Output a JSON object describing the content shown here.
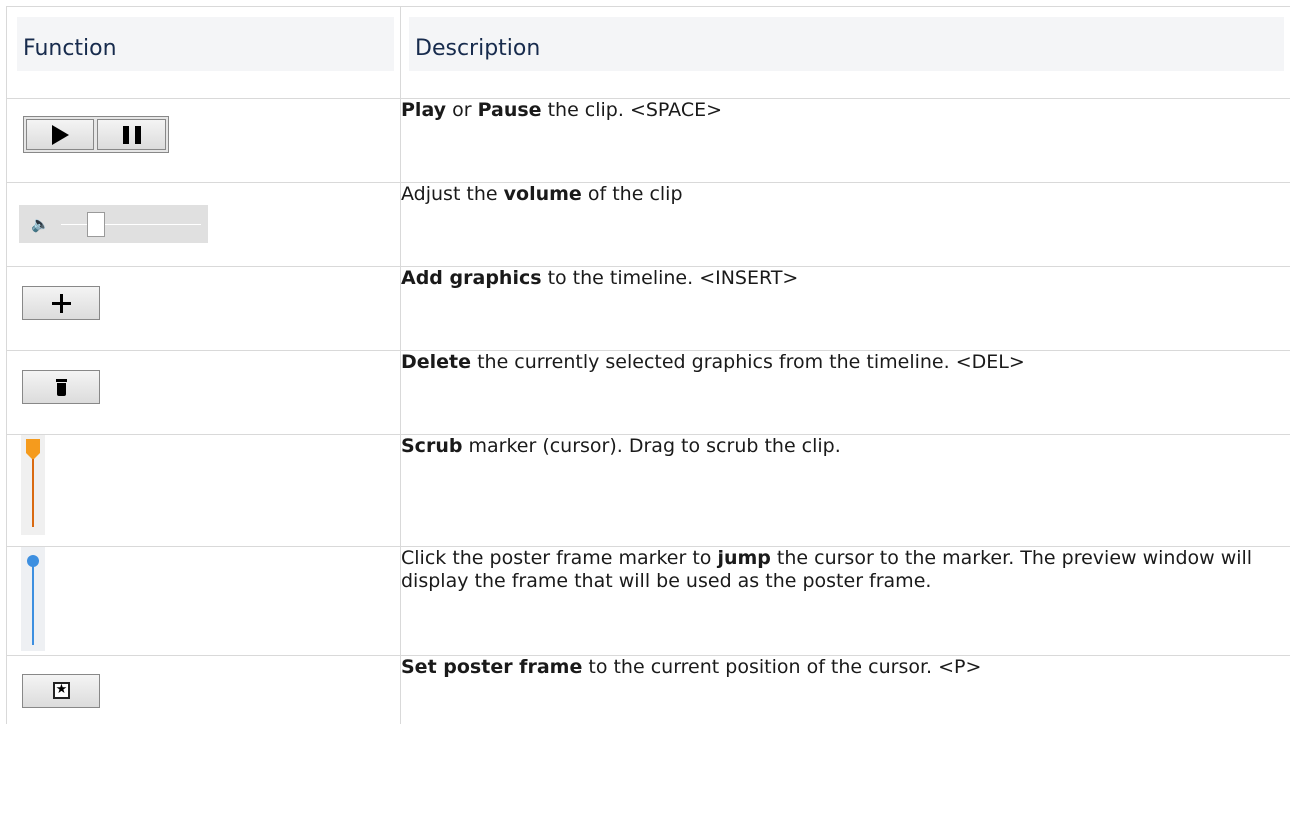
{
  "header": {
    "function": "Function",
    "description": "Description"
  },
  "rows": [
    {
      "icon": "play-pause-buttons",
      "parts": [
        {
          "b": "Play"
        },
        {
          "t": " or "
        },
        {
          "b": "Pause"
        },
        {
          "t": " the clip. <SPACE>"
        }
      ]
    },
    {
      "icon": "volume-slider",
      "parts": [
        {
          "t": "Adjust the "
        },
        {
          "b": "volume"
        },
        {
          "t": " of the clip"
        }
      ]
    },
    {
      "icon": "plus-button",
      "parts": [
        {
          "b": "Add graphics"
        },
        {
          "t": " to the timeline. <INSERT>"
        }
      ]
    },
    {
      "icon": "trash-button",
      "parts": [
        {
          "b": "Delete"
        },
        {
          "t": " the currently selected graphics from the timeline. <DEL>"
        }
      ]
    },
    {
      "icon": "scrub-marker",
      "parts": [
        {
          "b": "Scrub"
        },
        {
          "t": " marker (cursor). Drag to scrub the clip."
        }
      ]
    },
    {
      "icon": "poster-frame-marker",
      "parts": [
        {
          "t": "Click the poster frame marker to "
        },
        {
          "b": "jump"
        },
        {
          "t": " the cursor to the marker. The preview window will display the frame that will be used as the poster frame."
        }
      ]
    },
    {
      "icon": "set-poster-frame-button",
      "parts": [
        {
          "b": "Set poster frame"
        },
        {
          "t": " to the current position of the cursor. <P>"
        }
      ]
    }
  ],
  "colors": {
    "header_text": "#172b4d",
    "header_bg": "#f4f5f7",
    "scrub_marker": "#f59b1d",
    "poster_marker": "#3d8fe0"
  }
}
